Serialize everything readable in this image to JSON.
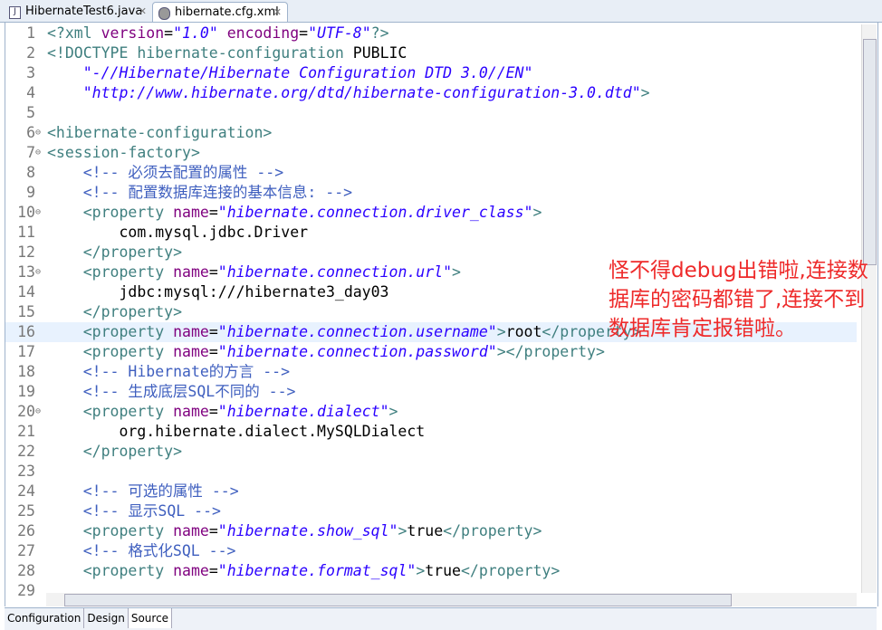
{
  "tabs": [
    {
      "label": "HibernateTest6.java",
      "icon": "java-file-icon",
      "active": false
    },
    {
      "label": "hibernate.cfg.xml",
      "icon": "xml-config-icon",
      "active": true
    }
  ],
  "bottom_tabs": [
    "Configuration",
    "Design",
    "Source"
  ],
  "active_bottom_tab": "Source",
  "current_line": 16,
  "lines": [
    [
      1,
      [
        [
          "pi",
          "<?xml "
        ],
        [
          "attr",
          "version"
        ],
        [
          "txt",
          "="
        ],
        [
          "str",
          "\"1.0\""
        ],
        [
          "attr",
          " encoding"
        ],
        [
          "txt",
          "="
        ],
        [
          "str",
          "\"UTF-8\""
        ],
        [
          "pi",
          "?>"
        ]
      ]
    ],
    [
      2,
      [
        [
          "tag",
          "<!DOCTYPE hibernate-configuration "
        ],
        [
          "txt",
          "PUBLIC"
        ]
      ]
    ],
    [
      3,
      [
        [
          "str",
          "    \"-//Hibernate/Hibernate Configuration DTD 3.0//EN\""
        ]
      ]
    ],
    [
      4,
      [
        [
          "str",
          "    \"http://www.hibernate.org/dtd/hibernate-configuration-3.0.dtd\""
        ],
        [
          "tag",
          ">"
        ]
      ]
    ],
    [
      5,
      []
    ],
    [
      6,
      [
        [
          "tag",
          "<hibernate-configuration>"
        ]
      ]
    ],
    [
      7,
      [
        [
          "tag",
          "<session-factory>"
        ]
      ]
    ],
    [
      8,
      [
        [
          "cmt",
          "    <!-- 必须去配置的属性 -->"
        ]
      ]
    ],
    [
      9,
      [
        [
          "cmt",
          "    <!-- 配置数据库连接的基本信息: -->"
        ]
      ]
    ],
    [
      10,
      [
        [
          "tag",
          "    <property "
        ],
        [
          "attr",
          "name"
        ],
        [
          "txt",
          "="
        ],
        [
          "str",
          "\"hibernate.connection.driver_class\""
        ],
        [
          "tag",
          ">"
        ]
      ]
    ],
    [
      11,
      [
        [
          "txt",
          "        com.mysql.jdbc.Driver"
        ]
      ]
    ],
    [
      12,
      [
        [
          "tag",
          "    </property>"
        ]
      ]
    ],
    [
      13,
      [
        [
          "tag",
          "    <property "
        ],
        [
          "attr",
          "name"
        ],
        [
          "txt",
          "="
        ],
        [
          "str",
          "\"hibernate.connection.url\""
        ],
        [
          "tag",
          ">"
        ]
      ]
    ],
    [
      14,
      [
        [
          "txt",
          "        jdbc:mysql:///hibernate3_day03"
        ]
      ]
    ],
    [
      15,
      [
        [
          "tag",
          "    </property>"
        ]
      ]
    ],
    [
      16,
      [
        [
          "tag",
          "    <property "
        ],
        [
          "attr",
          "name"
        ],
        [
          "txt",
          "="
        ],
        [
          "str",
          "\"hibernate.connection.username\""
        ],
        [
          "tag",
          ">"
        ],
        [
          "txt",
          "root"
        ],
        [
          "tag",
          "</property>"
        ]
      ]
    ],
    [
      17,
      [
        [
          "tag",
          "    <property "
        ],
        [
          "attr",
          "name"
        ],
        [
          "txt",
          "="
        ],
        [
          "str",
          "\"hibernate.connection.password\""
        ],
        [
          "tag",
          "></property>"
        ]
      ]
    ],
    [
      18,
      [
        [
          "cmt",
          "    <!-- Hibernate的方言 -->"
        ]
      ]
    ],
    [
      19,
      [
        [
          "cmt",
          "    <!-- 生成底层SQL不同的 -->"
        ]
      ]
    ],
    [
      20,
      [
        [
          "tag",
          "    <property "
        ],
        [
          "attr",
          "name"
        ],
        [
          "txt",
          "="
        ],
        [
          "str",
          "\"hibernate.dialect\""
        ],
        [
          "tag",
          ">"
        ]
      ]
    ],
    [
      21,
      [
        [
          "txt",
          "        org.hibernate.dialect.MySQLDialect"
        ]
      ]
    ],
    [
      22,
      [
        [
          "tag",
          "    </property>"
        ]
      ]
    ],
    [
      23,
      []
    ],
    [
      24,
      [
        [
          "cmt",
          "    <!-- 可选的属性 -->"
        ]
      ]
    ],
    [
      25,
      [
        [
          "cmt",
          "    <!-- 显示SQL -->"
        ]
      ]
    ],
    [
      26,
      [
        [
          "tag",
          "    <property "
        ],
        [
          "attr",
          "name"
        ],
        [
          "txt",
          "="
        ],
        [
          "str",
          "\"hibernate.show_sql\""
        ],
        [
          "tag",
          ">"
        ],
        [
          "txt",
          "true"
        ],
        [
          "tag",
          "</property>"
        ]
      ]
    ],
    [
      27,
      [
        [
          "cmt",
          "    <!-- 格式化SQL -->"
        ]
      ]
    ],
    [
      28,
      [
        [
          "tag",
          "    <property "
        ],
        [
          "attr",
          "name"
        ],
        [
          "txt",
          "="
        ],
        [
          "str",
          "\"hibernate.format_sql\""
        ],
        [
          "tag",
          ">"
        ],
        [
          "txt",
          "true"
        ],
        [
          "tag",
          "</property>"
        ]
      ]
    ],
    [
      29,
      []
    ]
  ],
  "fold_lines": [
    6,
    7,
    10,
    13,
    20
  ],
  "annotation": "怪不得debug出错啦,连接数据库的密码都错了,连接不到数据库肯定报错啦。",
  "annotation_color": "#ee2a2a",
  "scroll": {
    "vertical_position_pct": 0,
    "horizontal_position_pct": 0
  }
}
